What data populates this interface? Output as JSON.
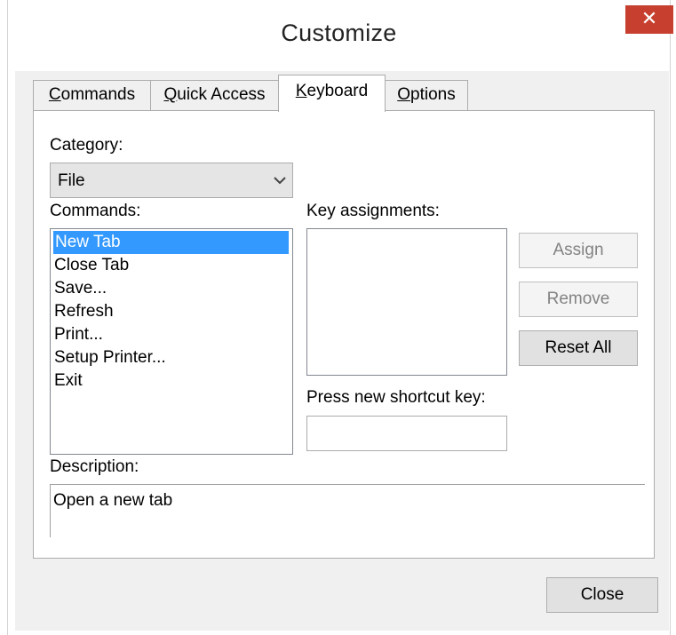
{
  "window": {
    "title": "Customize"
  },
  "tabs": [
    {
      "label": "Commands",
      "accel": "C",
      "rest": "ommands"
    },
    {
      "label": "Quick Access",
      "accel": "Q",
      "rest": "uick Access"
    },
    {
      "label": "Keyboard",
      "accel": "K",
      "rest": "eyboard"
    },
    {
      "label": "Options",
      "accel": "O",
      "rest": "ptions"
    }
  ],
  "active_tab": "Keyboard",
  "category": {
    "label": "Category:",
    "value": "File"
  },
  "commands": {
    "label": "Commands:",
    "items": [
      "New Tab",
      "Close Tab",
      "Save...",
      "Refresh",
      "Print...",
      "Setup Printer...",
      "Exit"
    ],
    "selected": "New Tab"
  },
  "key_assignments": {
    "label": "Key assignments:"
  },
  "shortcut": {
    "label": "Press new shortcut key:",
    "value": ""
  },
  "buttons": {
    "assign": "Assign",
    "remove": "Remove",
    "reset_all": "Reset All",
    "close": "Close"
  },
  "description": {
    "label": "Description:",
    "text": "Open a new tab"
  },
  "colors": {
    "close_button": "#c7402f",
    "selection": "#3399ff"
  }
}
